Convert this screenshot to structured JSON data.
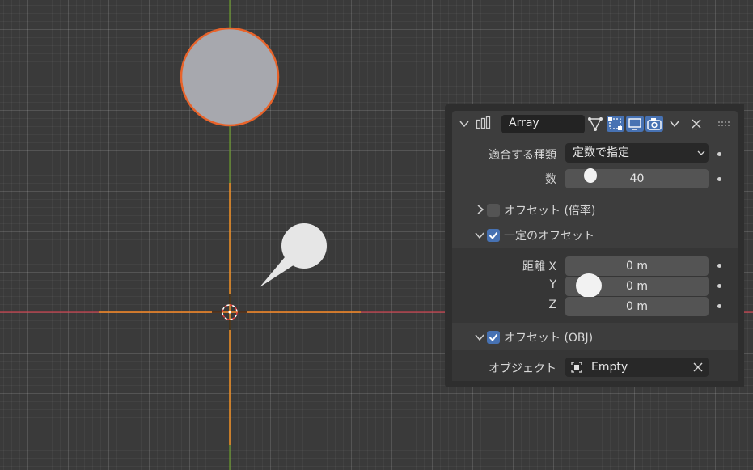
{
  "viewport": {
    "axis_x_color": "#c9414d",
    "axis_y_color": "#6a9b2a",
    "selection_color": "#f08a24",
    "object_color": "#a7a8ae"
  },
  "modifier": {
    "name": "Array",
    "icons": [
      "chevron-down-icon",
      "array-modifier-icon",
      "edit-mode-icon",
      "cage-icon",
      "realtime-display-icon",
      "render-icon",
      "dropdown-icon",
      "close-icon",
      "drag-handle-icon"
    ],
    "fit_type": {
      "label": "適合する種類",
      "value": "定数で指定"
    },
    "count": {
      "label": "数",
      "value": "40"
    },
    "relative_offset": {
      "label": "オフセット (倍率)",
      "checked": false,
      "expanded": false
    },
    "constant_offset": {
      "label": "一定のオフセット",
      "checked": true,
      "expanded": true
    },
    "distance": {
      "x_label": "距離 X",
      "x_value": "0 m",
      "y_label": "Y",
      "y_value": "0 m",
      "z_label": "Z",
      "z_value": "0 m"
    },
    "object_offset": {
      "label": "オフセット (OBJ)",
      "checked": true,
      "expanded": true
    },
    "offset_object": {
      "label": "オブジェクト",
      "value": "Empty"
    }
  }
}
